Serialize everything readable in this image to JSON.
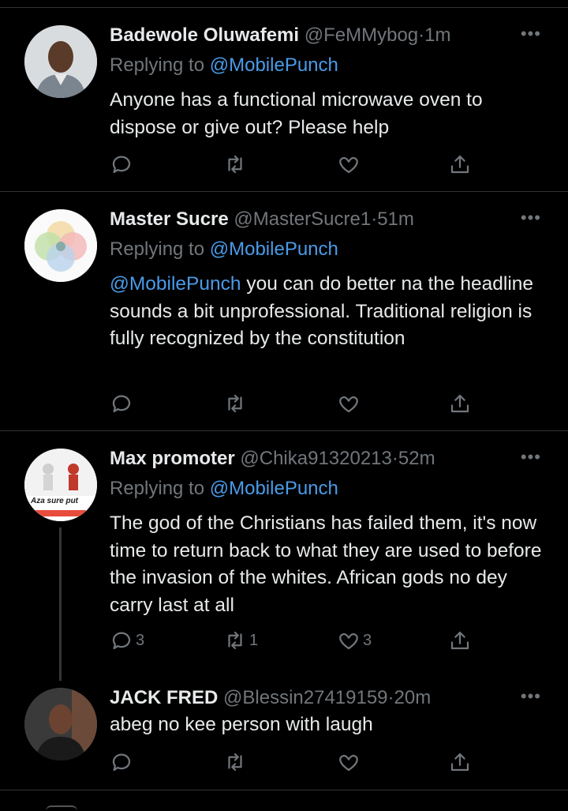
{
  "tweets": [
    {
      "name": "Badewole Oluwafemi",
      "handle": "@FeMMybog",
      "time": "1m",
      "reply_prefix": "Replying to ",
      "reply_to": "@MobilePunch",
      "text_mention": "",
      "text": "Anyone has a functional microwave oven to dispose or give out? Please help",
      "replies": "",
      "retweets": "",
      "likes": ""
    },
    {
      "name": "Master Sucre",
      "handle": "@MasterSucre1",
      "time": "51m",
      "reply_prefix": "Replying to ",
      "reply_to": "@MobilePunch",
      "text_mention": "@MobilePunch",
      "text": " you can do better na the headline sounds a bit unprofessional. Traditional religion is fully recognized by the constitution",
      "replies": "",
      "retweets": "",
      "likes": ""
    },
    {
      "name": "Max promoter",
      "handle": "@Chika91320213",
      "time": "52m",
      "reply_prefix": "Replying to ",
      "reply_to": "@MobilePunch",
      "text_mention": "",
      "text": "The god of the Christians has failed them, it's now time to return back to what they are used to before the invasion of the whites. African gods no dey carry last at all",
      "avatar_caption": "Aza sure put",
      "replies": "3",
      "retweets": "1",
      "likes": "3"
    },
    {
      "name": "JACK FRED",
      "handle": "@Blessin27419159",
      "time": "20m",
      "text": "abeg no kee person with laugh",
      "replies": "",
      "retweets": "",
      "likes": ""
    }
  ],
  "separator": "·",
  "more_glyph": "•••",
  "icons": [
    "reply-icon",
    "retweet-icon",
    "like-icon",
    "share-icon",
    "more-icon"
  ],
  "colors": {
    "background": "#000000",
    "text": "#e7e9ea",
    "muted": "#71767b",
    "link": "#4a9be8",
    "divider": "#2f3336"
  }
}
